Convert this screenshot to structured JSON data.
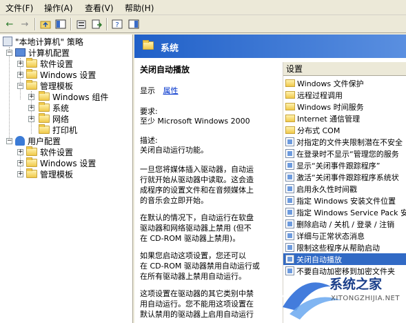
{
  "menubar": {
    "items": [
      "文件(F)",
      "操作(A)",
      "查看(V)",
      "帮助(H)"
    ]
  },
  "toolbar": {
    "buttons": [
      "back-icon",
      "forward-icon",
      "up-icon",
      "show-hide-tree-icon",
      "properties-icon",
      "export-icon",
      "help-icon",
      "action-pane-icon"
    ]
  },
  "tree": {
    "root": "\"本地计算机\" 策略",
    "computer": "计算机配置",
    "c_software": "软件设置",
    "c_windows": "Windows 设置",
    "c_admin": "管理模板",
    "c_admin_wincomp": "Windows 组件",
    "c_admin_system": "系统",
    "c_admin_network": "网络",
    "c_admin_printer": "打印机",
    "user": "用户配置",
    "u_software": "软件设置",
    "u_windows": "Windows 设置",
    "u_admin": "管理模板"
  },
  "header": {
    "title": "系统"
  },
  "description": {
    "title": "关闭自动播放",
    "show_label": "显示",
    "properties_link": "属性",
    "req_label": "要求:",
    "req_value": "至少 Microsoft Windows 2000",
    "desc_label": "描述:",
    "desc_value": "关闭自动运行功能。",
    "p1_l1": "一旦您将媒体插入驱动器，自动运",
    "p1_l2": "行就开始从驱动器中读取。这会造",
    "p1_l3": "成程序的设置文件和在音频媒体上",
    "p1_l4": "的音乐会立即开始。",
    "p2_l1": "在默认的情况下，自动运行在软盘",
    "p2_l2": "驱动器和网络驱动器上禁用 (但不",
    "p2_l3": "在 CD-ROM 驱动器上禁用)。",
    "p3_l1": "如果您启动这项设置，您还可以",
    "p3_l2": "在 CD-ROM 驱动器禁用自动运行或",
    "p3_l3": "在所有驱动器上禁用自动运行。",
    "p4_l1": "这项设置在驱动器的其它类别中禁",
    "p4_l2": "用自动运行。您不能用这项设置在",
    "p4_l3": "默认禁用的驱动器上启用自动运行"
  },
  "settings_list": {
    "header": "设置",
    "rows": [
      {
        "label": "Windows 文件保护",
        "type": "folder"
      },
      {
        "label": "远程过程调用",
        "type": "folder"
      },
      {
        "label": "Windows 时间服务",
        "type": "folder"
      },
      {
        "label": "Internet 通信管理",
        "type": "folder"
      },
      {
        "label": "分布式 COM",
        "type": "folder"
      },
      {
        "label": "对指定的文件夹限制潜在不安全",
        "type": "setting"
      },
      {
        "label": "在登录时不显示“管理您的服务",
        "type": "setting"
      },
      {
        "label": "显示“关闭事件跟踪程序”",
        "type": "setting"
      },
      {
        "label": "激活“关闭事件跟踪程序系统状",
        "type": "setting"
      },
      {
        "label": "启用永久性时间戳",
        "type": "setting"
      },
      {
        "label": "指定 Windows 安装文件位置",
        "type": "setting"
      },
      {
        "label": "指定 Windows Service Pack 安",
        "type": "setting"
      },
      {
        "label": "删除启动 / 关机 / 登录 / 注销",
        "type": "setting"
      },
      {
        "label": "详细与正常状态消息",
        "type": "setting"
      },
      {
        "label": "限制这些程序从帮助启动",
        "type": "setting"
      },
      {
        "label": "关闭自动播放",
        "type": "setting"
      },
      {
        "label": "不要自动加密移到加密文件夹",
        "type": "setting"
      }
    ]
  },
  "watermark": {
    "brand": "系统之家",
    "url": "XITONGZHIJIA.NET"
  }
}
